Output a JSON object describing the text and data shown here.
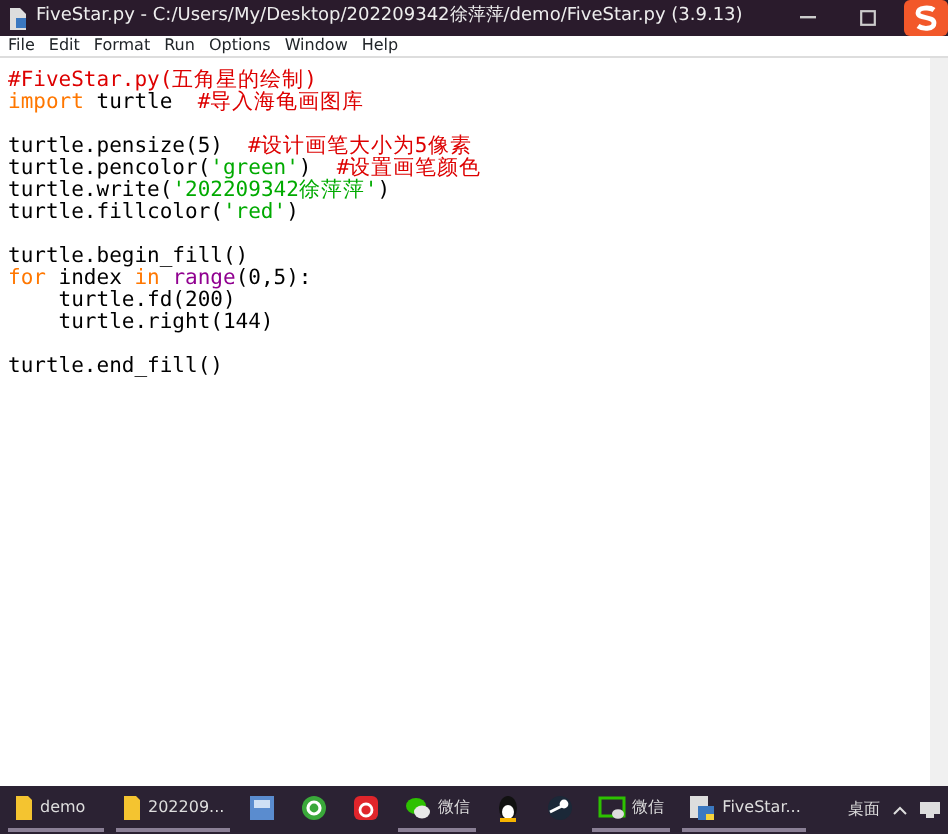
{
  "window": {
    "title": "FiveStar.py - C:/Users/My/Desktop/202209342徐萍萍/demo/FiveStar.py (3.9.13)"
  },
  "menu": [
    "File",
    "Edit",
    "Format",
    "Run",
    "Options",
    "Window",
    "Help"
  ],
  "code_lines": [
    {
      "kind": "code",
      "segments": [
        {
          "kind": "comment",
          "text": "#FiveStar.py(五角星的绘制)"
        }
      ]
    },
    {
      "kind": "code",
      "segments": [
        {
          "kind": "keyword",
          "text": "import"
        },
        {
          "kind": "plain",
          "text": " turtle  "
        },
        {
          "kind": "comment",
          "text": "#导入海龟画图库"
        }
      ]
    },
    {
      "kind": "blank"
    },
    {
      "kind": "code",
      "segments": [
        {
          "kind": "plain",
          "text": "turtle.pensize(5)  "
        },
        {
          "kind": "comment",
          "text": "#设计画笔大小为5像素"
        }
      ]
    },
    {
      "kind": "code",
      "segments": [
        {
          "kind": "plain",
          "text": "turtle.pencolor("
        },
        {
          "kind": "string",
          "text": "'green'"
        },
        {
          "kind": "plain",
          "text": ")  "
        },
        {
          "kind": "comment",
          "text": "#设置画笔颜色"
        }
      ]
    },
    {
      "kind": "code",
      "segments": [
        {
          "kind": "plain",
          "text": "turtle.write("
        },
        {
          "kind": "string",
          "text": "'202209342徐萍萍'"
        },
        {
          "kind": "plain",
          "text": ")"
        }
      ]
    },
    {
      "kind": "code",
      "segments": [
        {
          "kind": "plain",
          "text": "turtle.fillcolor("
        },
        {
          "kind": "string",
          "text": "'red'"
        },
        {
          "kind": "plain",
          "text": ")"
        }
      ]
    },
    {
      "kind": "blank"
    },
    {
      "kind": "code",
      "segments": [
        {
          "kind": "plain",
          "text": "turtle.begin_fill()"
        }
      ]
    },
    {
      "kind": "code",
      "segments": [
        {
          "kind": "keyword",
          "text": "for"
        },
        {
          "kind": "plain",
          "text": " index "
        },
        {
          "kind": "keyword",
          "text": "in"
        },
        {
          "kind": "builtin",
          "text": "range",
          "space_before": true
        },
        {
          "kind": "plain",
          "text": "(0,5):"
        }
      ]
    },
    {
      "kind": "code",
      "segments": [
        {
          "kind": "plain",
          "text": "    turtle.fd(200)"
        }
      ]
    },
    {
      "kind": "code",
      "segments": [
        {
          "kind": "plain",
          "text": "    turtle.right(144)"
        }
      ]
    },
    {
      "kind": "blank"
    },
    {
      "kind": "code",
      "segments": [
        {
          "kind": "plain",
          "text": "turtle.end_fill()"
        }
      ]
    }
  ],
  "taskbar": [
    {
      "kind": "folder",
      "label": "demo"
    },
    {
      "kind": "folder",
      "label": "202209..."
    },
    {
      "kind": "app"
    },
    {
      "kind": "app"
    },
    {
      "kind": "app"
    },
    {
      "kind": "app",
      "label": "微信"
    },
    {
      "kind": "app"
    },
    {
      "kind": "app"
    },
    {
      "kind": "app",
      "label": "微信"
    },
    {
      "kind": "app",
      "label": "FiveStar..."
    }
  ],
  "tray": {
    "label": "桌面"
  }
}
